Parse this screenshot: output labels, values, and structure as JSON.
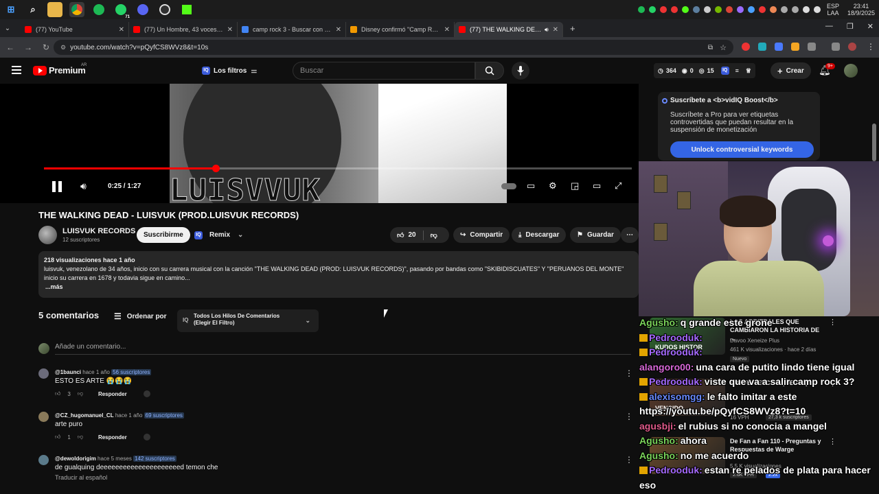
{
  "taskbar": {
    "tray_lang": "ESP",
    "tray_layout": "LAA",
    "time": "23:41",
    "date": "18/9/2025",
    "whatsapp_badge": "71"
  },
  "browser": {
    "tabs": [
      {
        "label": "(77) YouTube",
        "color": "#ff0000"
      },
      {
        "label": "(77) Un Hombre, 43 voces (con",
        "color": "#ff0000"
      },
      {
        "label": "camp rock 3 - Buscar con Goog",
        "color": "#4285f4"
      },
      {
        "label": "Disney confirmó \"Camp Rock 3\"",
        "color": "#f29900"
      },
      {
        "label": "(77) THE WALKING DEAD -",
        "color": "#ff0000"
      }
    ],
    "new_tab": "+",
    "url": "youtube.com/watch?v=pQyfCS8WVz8&t=10s"
  },
  "yt_header": {
    "logo_text": "Premium",
    "country": "AR",
    "filters_label": "Los filtros",
    "search_placeholder": "Buscar",
    "stat_views": "364",
    "stat_zero": "0",
    "stat_fifteen": "15",
    "create_label": "Crear",
    "notif_count": "9+"
  },
  "player": {
    "wordmark": "LUISVVUK",
    "time": "0:25 / 1:27",
    "progress": 0.292
  },
  "video": {
    "title": "THE WALKING DEAD - LUISVUK (PROD.LUISVUK RECORDS)",
    "channel": "LUISVUK RECORDS",
    "subscribers": "12 suscriptores",
    "subscribe_label": "Suscribirme",
    "remix_label": "Remix",
    "likes": "20",
    "share_label": "Compartir",
    "download_label": "Descargar",
    "save_label": "Guardar",
    "desc_meta": "218 visualizaciones  hace 1 año",
    "desc_line1": "luisvuk, venezolano de 34 años, inicio con su carrera musical con la canción \"THE WALKING DEAD (PROD: LUISVUK RECORDS)\", pasando por bandas como \"SKIBIDISCUATES\" Y \"PERUANOS DEL MONTE\"",
    "desc_line2": "inicio su carrera en 1678 y todavia sigue en camino...",
    "desc_more": "...más"
  },
  "comments": {
    "count": "5 comentarios",
    "sort_label": "Ordenar por",
    "filter_line1": "Todos Los Hilos De Comentarios",
    "filter_line2": "(Elegir El Filtro)",
    "add_placeholder": "Añade un comentario...",
    "reply_label": "Responder",
    "items": [
      {
        "handle": "@1baunci",
        "time": "hace 1 año",
        "subs": "56 suscriptores",
        "text": "ESTO ES ARTE 😭😭😭",
        "likes": "3",
        "color": "#6b6b7a"
      },
      {
        "handle": "@CZ_hugomanuel_CL",
        "time": "hace 1 año",
        "subs": "69 suscriptores",
        "text": "arte puro",
        "likes": "1",
        "color": "#8a7a5a"
      },
      {
        "handle": "@dewoldorigim",
        "time": "hace 5 meses",
        "subs": "142 suscriptores",
        "text": "de gualquing deeeeeeeeeeeeeeeeeeeeed temon che",
        "translate": "Traducir al español",
        "color": "#5a7a8a"
      }
    ]
  },
  "vidiq": {
    "title": "Suscríbete a <b>vidIQ Boost</b>",
    "text": "Suscríbete a Pro para ver etiquetas controvertidas que puedan resultar en la suspensión de monetización",
    "button": "Unlock controversial keywords"
  },
  "reco": [
    {
      "title": "LOS ARBITRALES QUE CAMBIARON LA HISTORIA DE ...",
      "channel": "Davoo Xeneize Plus",
      "meta": "461 K visualizaciones · hace 2 días",
      "tag": "Nuevo",
      "thumb_label": "KUDOS HISTOR",
      "color": "#2f6a2f"
    },
    {
      "title": "PROFE VENCIDO | #ElGalpón",
      "meta": "16 VPH",
      "tag": "27,3 k suscriptores",
      "thumb_label": "VENCIDO",
      "color": "#5a3a2a"
    },
    {
      "title": "De Fan a Fan 110 - Preguntas y Respuestas de Warge",
      "meta": "5,5 K visualizaciones",
      "tag": "2.6K VPH",
      "extra": "2.2x",
      "color": "#6a4a2a"
    }
  ],
  "chat": [
    {
      "user": "Agusho:",
      "msg": "q grande este grone",
      "color": "#7ad35a",
      "crown": false
    },
    {
      "user": "Pedrooduk:",
      "msg": "",
      "color": "#a66bff",
      "crown": true
    },
    {
      "user": "Pedrooduk:",
      "msg": "",
      "color": "#a66bff",
      "crown": true
    },
    {
      "user": "alangoro00:",
      "msg": "una cara de putito lindo tiene igual",
      "color": "#d868d8",
      "crown": false
    },
    {
      "user": "Pedrooduk:",
      "msg": "viste que va a salir camp rock 3?",
      "color": "#a66bff",
      "crown": true
    },
    {
      "user": "alexisomgg:",
      "msg": "le falto imitar a este",
      "color": "#6a8aff",
      "crown": true
    },
    {
      "user": "",
      "msg": "https://youtu.be/pQyfCS8WVz8?t=10",
      "color": "#fff",
      "crown": false
    },
    {
      "user": "agusbji:",
      "msg": "el rubius si no conocia a mangel",
      "color": "#e05a8a",
      "crown": false
    },
    {
      "user": "Agusho:",
      "msg": "ahora",
      "color": "#7ad35a",
      "crown": false
    },
    {
      "user": "Agusho:",
      "msg": "no me acuerdo",
      "color": "#7ad35a",
      "crown": false
    },
    {
      "user": "Pedrooduk:",
      "msg": "estan re pelados de plata para hacer",
      "color": "#a66bff",
      "crown": true
    },
    {
      "user": "",
      "msg": "eso",
      "color": "#fff",
      "crown": false
    }
  ]
}
